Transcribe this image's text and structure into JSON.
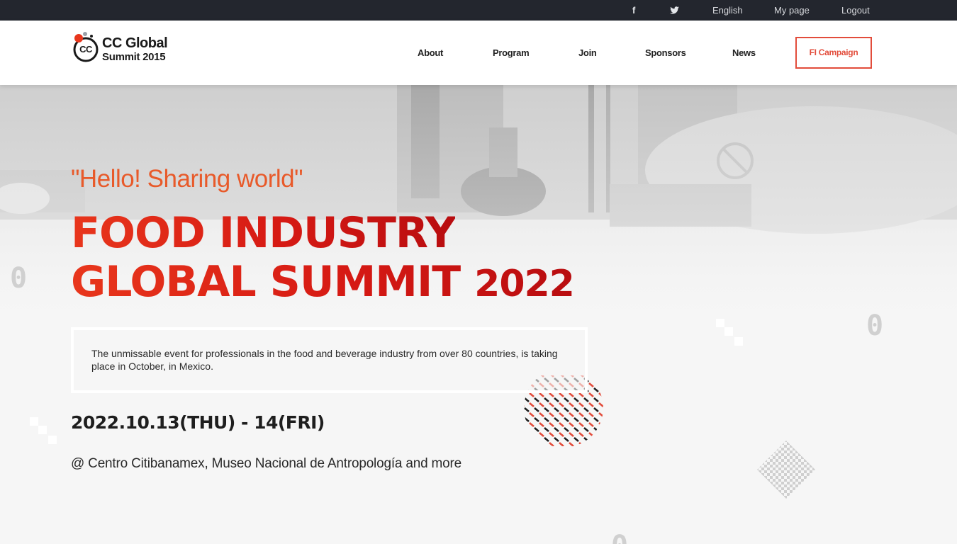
{
  "topbar": {
    "facebook_glyph": "f",
    "twitter_glyph": "🐦",
    "language": "English",
    "my_page": "My page",
    "logout": "Logout"
  },
  "logo": {
    "line1": "CC Global",
    "line2": "Summit 2015",
    "badge": "CC"
  },
  "nav": {
    "about": "About",
    "program": "Program",
    "join": "Join",
    "sponsors": "Sponsors",
    "news": "News",
    "campaign": "FI Campaign"
  },
  "hero": {
    "tagline": "\"Hello! Sharing world\"",
    "title_line1": "FOOD INDUSTRY",
    "title_line2": "GLOBAL SUMMIT",
    "title_year": "2022",
    "description": "The unmissable event for professionals in the food and beverage industry from over 80 countries, is taking place in October, in Mexico.",
    "date": "2022.10.13(THU) - 14(FRI)",
    "venue": "@ Centro Citibanamex, Museo Nacional de Antropología and more",
    "deco_zero": "0"
  },
  "colors": {
    "topbar_bg": "#23262e",
    "accent": "#e24c3b",
    "title_red": "#d61a14",
    "tagline_orange": "#e85a2a"
  }
}
